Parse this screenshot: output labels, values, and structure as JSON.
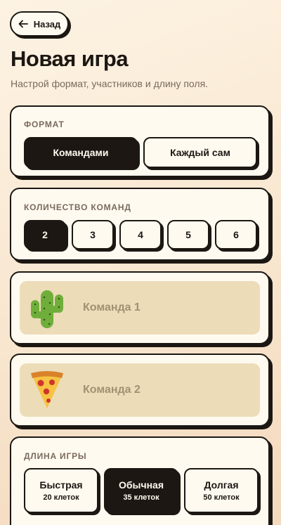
{
  "header": {
    "back_label": "Назад",
    "title": "Новая игра",
    "subtitle": "Настрой формат, участников и длину поля."
  },
  "format": {
    "label": "ФОРМАТ",
    "options": [
      "Командами",
      "Каждый сам"
    ],
    "selected": "Командами"
  },
  "team_count": {
    "label": "КОЛИЧЕСТВО КОМАНД",
    "options": [
      "2",
      "3",
      "4",
      "5",
      "6"
    ],
    "selected": "2"
  },
  "teams": [
    {
      "name": "Команда 1",
      "icon": "cactus-icon"
    },
    {
      "name": "Команда 2",
      "icon": "pizza-icon"
    }
  ],
  "length": {
    "label": "ДЛИНА ИГРЫ",
    "options": [
      {
        "title": "Быстрая",
        "cells": "20 клеток"
      },
      {
        "title": "Обычная",
        "cells": "35 клеток"
      },
      {
        "title": "Долгая",
        "cells": "50 клеток"
      }
    ],
    "selected": "Обычная"
  },
  "colors": {
    "ink": "#1c1712",
    "card": "#fffaf0",
    "team_bg": "#ecdcb8",
    "muted": "#7a6a5c"
  }
}
